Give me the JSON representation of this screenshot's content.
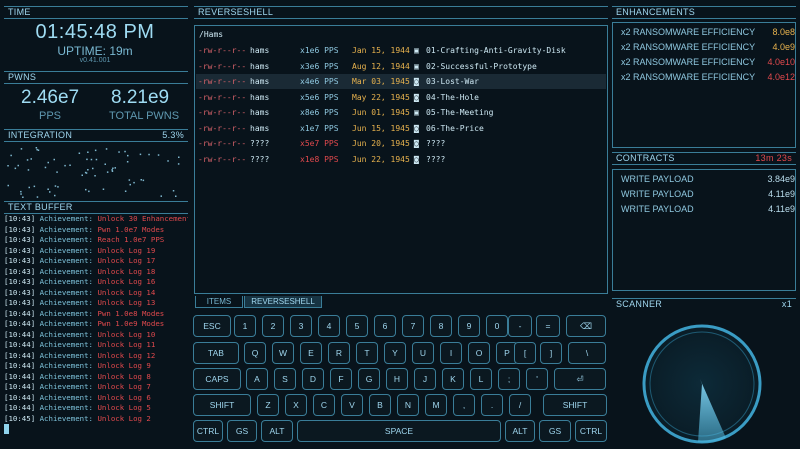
{
  "time_panel": {
    "title": "TIME",
    "clock": "01:45:48 PM",
    "uptime": "UPTIME: 19m",
    "version": "v0.41.001"
  },
  "pwns_panel": {
    "title": "PWNS",
    "pps_value": "2.46e7",
    "pps_label": "PPS",
    "total_value": "8.21e9",
    "total_label": "TOTAL PWNS"
  },
  "integration_panel": {
    "title": "INTEGRATION",
    "percent": "5.3%"
  },
  "text_buffer": {
    "title": "TEXT BUFFER",
    "lines": [
      {
        "ts": "[10:43]",
        "label": "Achievement:",
        "msg": "Unlock 30 Enhancements",
        "color": "red"
      },
      {
        "ts": "[10:43]",
        "label": "Achievement:",
        "msg": "Pwn 1.0e7 Modes",
        "color": "red"
      },
      {
        "ts": "[10:43]",
        "label": "Achievement:",
        "msg": "Reach 1.0e7 PPS",
        "color": "red"
      },
      {
        "ts": "[10:43]",
        "label": "Achievement:",
        "msg": "Unlock Log 19",
        "color": "red"
      },
      {
        "ts": "[10:43]",
        "label": "Achievement:",
        "msg": "Unlock Log 17",
        "color": "red"
      },
      {
        "ts": "[10:43]",
        "label": "Achievement:",
        "msg": "Unlock Log 18",
        "color": "red"
      },
      {
        "ts": "[10:43]",
        "label": "Achievement:",
        "msg": "Unlock Log 16",
        "color": "red"
      },
      {
        "ts": "[10:43]",
        "label": "Achievement:",
        "msg": "Unlock Log 14",
        "color": "red"
      },
      {
        "ts": "[10:43]",
        "label": "Achievement:",
        "msg": "Unlock Log 13",
        "color": "red"
      },
      {
        "ts": "[10:44]",
        "label": "Achievement:",
        "msg": "Pwn 1.0e8 Modes",
        "color": "red"
      },
      {
        "ts": "[10:44]",
        "label": "Achievement:",
        "msg": "Pwn 1.0e9 Modes",
        "color": "red"
      },
      {
        "ts": "[10:44]",
        "label": "Achievement:",
        "msg": "Unlock Log 10",
        "color": "red"
      },
      {
        "ts": "[10:44]",
        "label": "Achievement:",
        "msg": "Unlock Log 11",
        "color": "red"
      },
      {
        "ts": "[10:44]",
        "label": "Achievement:",
        "msg": "Unlock Log 12",
        "color": "red"
      },
      {
        "ts": "[10:44]",
        "label": "Achievement:",
        "msg": "Unlock Log 9",
        "color": "red"
      },
      {
        "ts": "[10:44]",
        "label": "Achievement:",
        "msg": "Unlock Log 8",
        "color": "red"
      },
      {
        "ts": "[10:44]",
        "label": "Achievement:",
        "msg": "Unlock Log 7",
        "color": "red"
      },
      {
        "ts": "[10:44]",
        "label": "Achievement:",
        "msg": "Unlock Log 6",
        "color": "red"
      },
      {
        "ts": "[10:44]",
        "label": "Achievement:",
        "msg": "Unlock Log 5",
        "color": "red"
      },
      {
        "ts": "[10:45]",
        "label": "Achievement:",
        "msg": "Unlock Log 2",
        "color": "red"
      }
    ]
  },
  "shell": {
    "title": "REVERSESHELL",
    "path": "/Hams",
    "files": [
      {
        "perm": "-rw-r--r--",
        "owner": "hams",
        "pps": "x1e6 PPS",
        "pps_color": "normal",
        "date": "Jan 15, 1944",
        "icon": "image-icon",
        "type_glyph": "▣",
        "name": "01-Crafting-Anti-Gravity-Disk",
        "selected": false
      },
      {
        "perm": "-rw-r--r--",
        "owner": "hams",
        "pps": "x3e6 PPS",
        "pps_color": "normal",
        "date": "Aug 12, 1944",
        "icon": "image-icon",
        "type_glyph": "▣",
        "name": "02-Successful-Prototype",
        "selected": false
      },
      {
        "perm": "-rw-r--r--",
        "owner": "hams",
        "pps": "x4e6 PPS",
        "pps_color": "normal",
        "date": "Mar 03, 1945",
        "icon": "camera-icon",
        "type_glyph": "◙",
        "name": "03-Lost-War",
        "selected": true
      },
      {
        "perm": "-rw-r--r--",
        "owner": "hams",
        "pps": "x5e6 PPS",
        "pps_color": "normal",
        "date": "May 22, 1945",
        "icon": "camera-icon",
        "type_glyph": "◙",
        "name": "04-The-Hole",
        "selected": false
      },
      {
        "perm": "-rw-r--r--",
        "owner": "hams",
        "pps": "x8e6 PPS",
        "pps_color": "normal",
        "date": "Jun 01, 1945",
        "icon": "image-icon",
        "type_glyph": "▣",
        "name": "05-The-Meeting",
        "selected": false
      },
      {
        "perm": "-rw-r--r--",
        "owner": "hams",
        "pps": "x1e7 PPS",
        "pps_color": "normal",
        "date": "Jun 15, 1945",
        "icon": "camera-icon",
        "type_glyph": "◙",
        "name": "06-The-Price",
        "selected": false
      },
      {
        "perm": "-rw-r--r--",
        "owner": "????",
        "pps": "x5e7 PPS",
        "pps_color": "red",
        "date": "Jun 20, 1945",
        "icon": "camera-icon",
        "type_glyph": "◙",
        "name": "????",
        "selected": false
      },
      {
        "perm": "-rw-r--r--",
        "owner": "????",
        "pps": "x1e8 PPS",
        "pps_color": "red",
        "date": "Jun 22, 1945",
        "icon": "camera-icon",
        "type_glyph": "◙",
        "name": "????",
        "selected": false
      }
    ]
  },
  "bottom_tabs": [
    {
      "label": "ITEMS",
      "active": false
    },
    {
      "label": "REVERSESHELL",
      "active": true
    }
  ],
  "keyboard": {
    "rows": [
      [
        "ESC",
        "1",
        "2",
        "3",
        "4",
        "5",
        "6",
        "7",
        "8",
        "9",
        "0",
        "-",
        "=",
        "⌫"
      ],
      [
        "TAB",
        "Q",
        "W",
        "E",
        "R",
        "T",
        "Y",
        "U",
        "I",
        "O",
        "P",
        "[",
        "]",
        "\\"
      ],
      [
        "CAPS",
        "A",
        "S",
        "D",
        "F",
        "G",
        "H",
        "J",
        "K",
        "L",
        ";",
        "'",
        "⏎"
      ],
      [
        "SHIFT",
        "Z",
        "X",
        "C",
        "V",
        "B",
        "N",
        "M",
        ",",
        ".",
        "/",
        "SHIFT"
      ],
      [
        "CTRL",
        "GS",
        "ALT",
        "SPACE",
        "ALT",
        "GS",
        "CTRL"
      ]
    ]
  },
  "enhancements": {
    "title": "ENHANCEMENTS",
    "items": [
      {
        "name": "x2 RANSOMWARE EFFICIENCY",
        "value": "8.0e8",
        "color": "yellow"
      },
      {
        "name": "x2 RANSOMWARE EFFICIENCY",
        "value": "4.0e9",
        "color": "yellow"
      },
      {
        "name": "x2 RANSOMWARE EFFICIENCY",
        "value": "4.0e10",
        "color": "red"
      },
      {
        "name": "x2 RANSOMWARE EFFICIENCY",
        "value": "4.0e12",
        "color": "red"
      }
    ]
  },
  "contracts": {
    "title": "CONTRACTS",
    "timer": "13m 23s",
    "items": [
      {
        "name": "WRITE PAYLOAD",
        "value": "3.84e9"
      },
      {
        "name": "WRITE PAYLOAD",
        "value": "4.11e9"
      },
      {
        "name": "WRITE PAYLOAD",
        "value": "4.11e9"
      }
    ]
  },
  "scanner": {
    "title": "SCANNER",
    "multiplier": "x1"
  },
  "colors": {
    "accent": "#3a7d98",
    "text": "#8fc8e0",
    "alert": "#e0494d",
    "warn": "#e7b24e"
  }
}
